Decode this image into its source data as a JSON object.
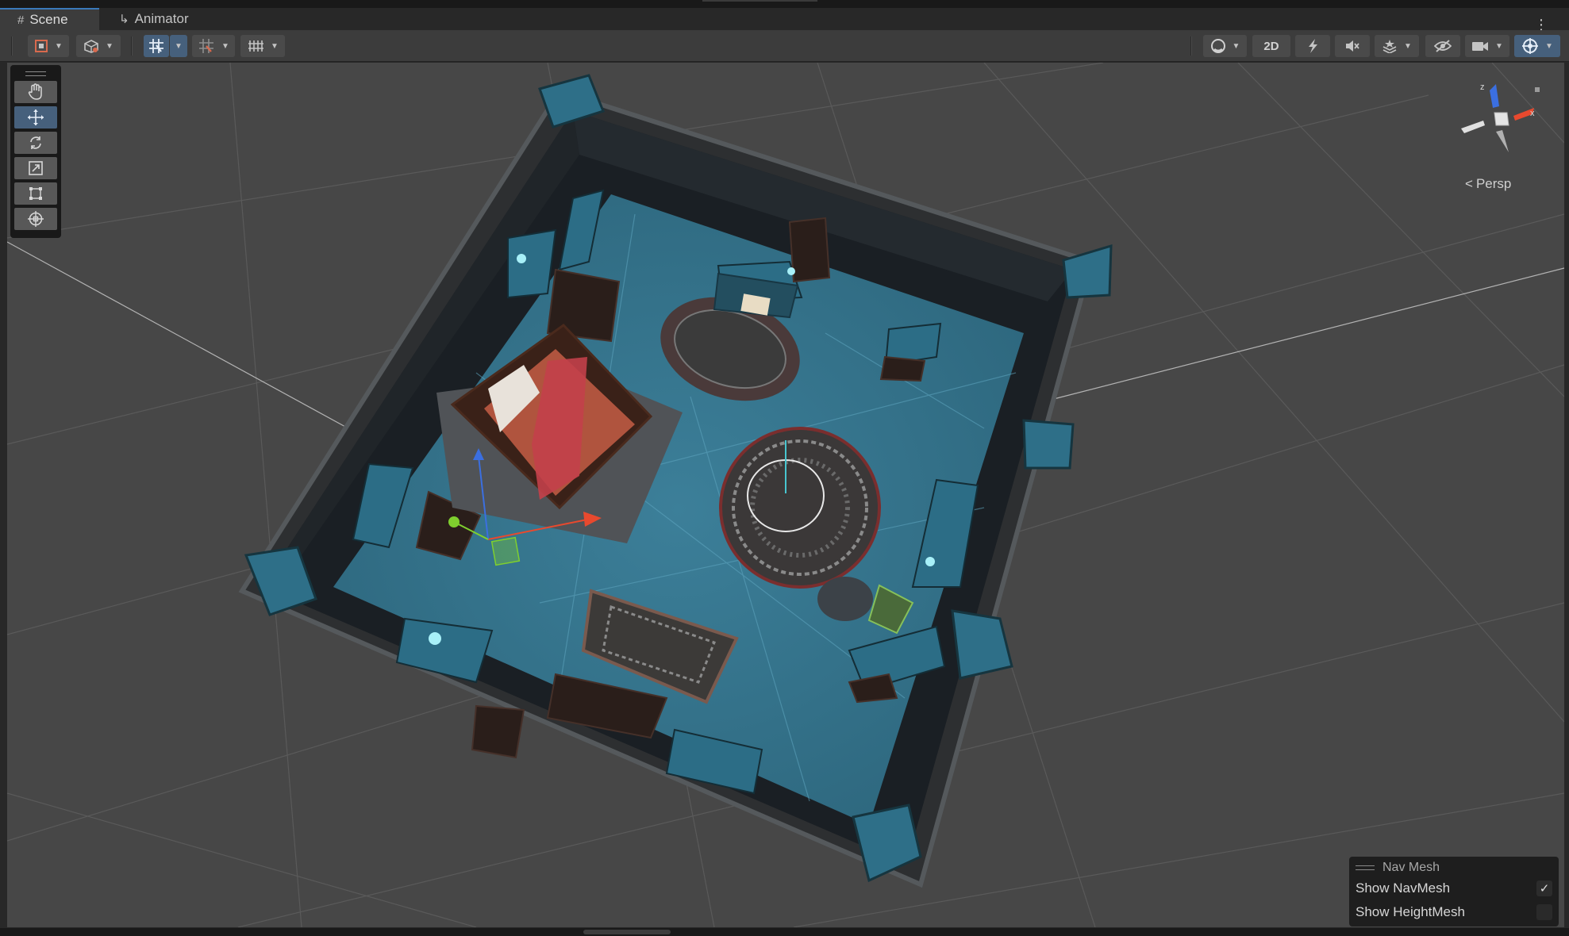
{
  "tabs": [
    {
      "label": "Scene",
      "glyph": "#",
      "active": true
    },
    {
      "label": "Animator",
      "glyph": "↳",
      "active": false
    }
  ],
  "toolbar": {
    "label_2d": "2D",
    "left_icons": [
      "draw-mode-icon",
      "shading-icon",
      "grid-snap-icon",
      "increment-snap-icon",
      "grid-visibility-icon"
    ],
    "right_icons": [
      "render-mode-sphere-icon",
      "lighting-icon",
      "audio-mute-icon",
      "effects-icon",
      "hidden-objects-icon",
      "camera-icon",
      "gizmos-icon"
    ]
  },
  "tools": [
    {
      "name": "hand-tool",
      "icon": "hand-icon",
      "active": false
    },
    {
      "name": "move-tool",
      "icon": "move-arrows-icon",
      "active": true
    },
    {
      "name": "rotate-tool",
      "icon": "rotate-icon",
      "active": false
    },
    {
      "name": "scale-tool",
      "icon": "scale-icon",
      "active": false
    },
    {
      "name": "rect-tool",
      "icon": "rect-icon",
      "active": false
    },
    {
      "name": "transform-tool",
      "icon": "transform-icon",
      "active": false
    }
  ],
  "gizmo": {
    "axis_z": "z",
    "axis_x": "x",
    "projection_label": "Persp",
    "projection_glyph": "<"
  },
  "navmesh": {
    "title": "Nav Mesh",
    "show_navmesh_label": "Show NavMesh",
    "show_navmesh_checked": true,
    "show_heightmesh_label": "Show HeightMesh",
    "show_heightmesh_checked": false,
    "check_glyph": "✓"
  },
  "colors": {
    "accent": "#3a79bb",
    "navmesh_floor": "#2f6d86",
    "wall": "#1c2227",
    "axis_x": "#e8492e",
    "axis_y": "#7fcf2e",
    "axis_z": "#3b6fe0"
  }
}
